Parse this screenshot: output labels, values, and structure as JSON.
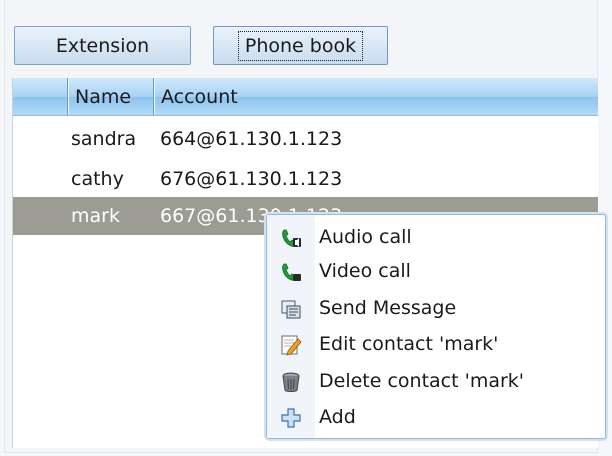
{
  "tabs": {
    "extension": "Extension",
    "phone_book": "Phone book"
  },
  "table": {
    "columns": [
      "",
      "Name",
      "Account"
    ],
    "rows": [
      {
        "name": "sandra",
        "account": "664@61.130.1.123"
      },
      {
        "name": "cathy",
        "account": "676@61.130.1.123"
      },
      {
        "name": "mark",
        "account": "667@61.130.1.123",
        "selected": true
      }
    ]
  },
  "context_menu": {
    "items": [
      {
        "label": "Audio call",
        "icon": "phone-audio-icon"
      },
      {
        "label": "Video call",
        "icon": "phone-video-icon"
      },
      {
        "label": "Send Message",
        "icon": "message-icon"
      },
      {
        "label": "Edit contact 'mark'",
        "icon": "edit-icon"
      },
      {
        "label": "Delete contact 'mark'",
        "icon": "trash-icon"
      },
      {
        "label": "Add",
        "icon": "add-icon"
      }
    ]
  },
  "colors": {
    "header_blue": "#a9d2f3",
    "selected_row": "#9c9c94",
    "phone_green": "#1e9a3a"
  }
}
